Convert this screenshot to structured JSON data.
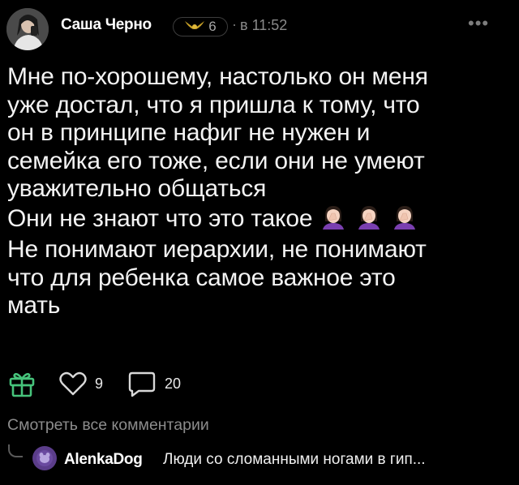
{
  "post": {
    "author": "Саша Черно",
    "rank_level": "6",
    "dot": "·",
    "time": "в 11:52",
    "more": "•••",
    "lines": [
      "Мне по-хорошему, настолько он меня",
      "уже достал, что я пришла к тому, что",
      "он в принципе нафиг не нужен и",
      "семейка его тоже, если они не умеют",
      "уважительно общаться",
      "Они не знают что это такое",
      "Не понимают иерархии, не понимают",
      "что для ребенка самое важное это",
      "мать"
    ],
    "emojis": [
      "woman-facepalming-icon",
      "woman-facepalming-icon",
      "woman-facepalming-icon"
    ]
  },
  "actions": {
    "likes": "9",
    "comments": "20"
  },
  "comments": {
    "view_all": "Смотреть все комментарии",
    "preview": {
      "author": "AlenkaDog",
      "text": "Люди со сломанными ногами в гип..."
    }
  },
  "colors": {
    "background": "#000000",
    "gift": "#46c37b",
    "muted": "#8c8c8c"
  }
}
